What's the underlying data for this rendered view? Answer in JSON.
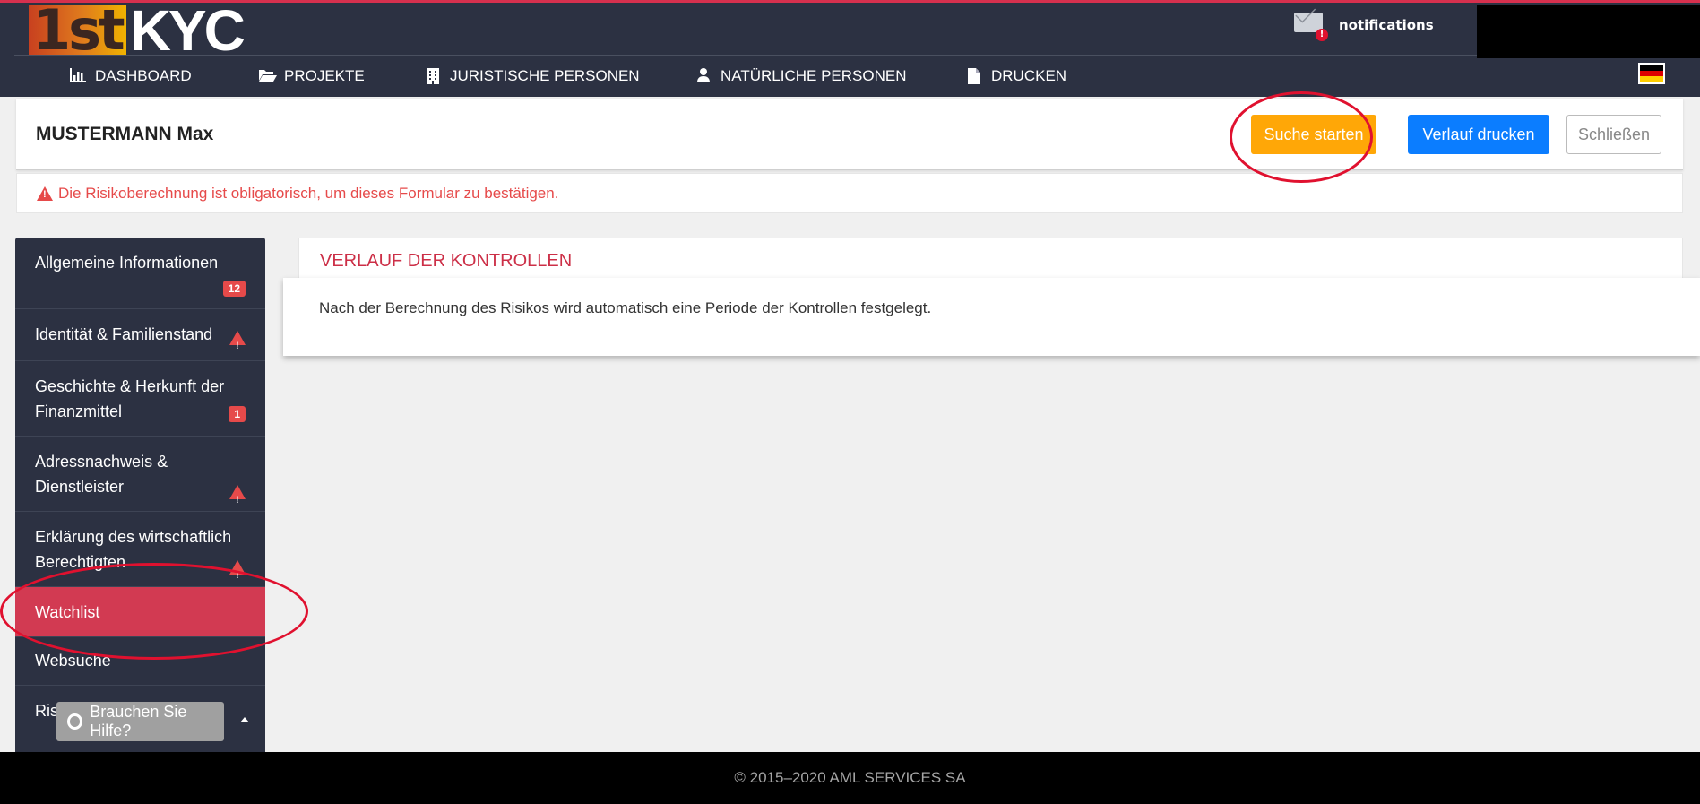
{
  "header": {
    "logo_first": "1st",
    "logo_kyc": "KYC",
    "notifications_label": "notifications",
    "notifications_badge": "!",
    "nav": [
      {
        "label": "DASHBOARD",
        "icon": "bar-chart-icon"
      },
      {
        "label": "PROJEKTE",
        "icon": "folder-open-icon"
      },
      {
        "label": "JURISTISCHE PERSONEN",
        "icon": "building-icon"
      },
      {
        "label": "NATÜRLICHE PERSONEN",
        "icon": "user-icon",
        "active": true
      },
      {
        "label": "DRUCKEN",
        "icon": "document-icon"
      }
    ],
    "language_flag": "german-flag-icon"
  },
  "titlebar": {
    "name": "MUSTERMANN Max",
    "search_button": "Suche starten",
    "print_button": "Verlauf drucken",
    "close_button": "Schließen"
  },
  "warning": {
    "message": "Die Risikoberechnung ist obligatorisch, um dieses Formular zu bestätigen."
  },
  "sidebar": {
    "items": [
      {
        "label": "Allgemeine Informationen",
        "badge": "12"
      },
      {
        "label": "Identität & Familienstand",
        "warning": true
      },
      {
        "label": "Geschichte & Herkunft der Finanzmittel",
        "badge": "1"
      },
      {
        "label": "Adressnachweis & Dienstleister",
        "warning": true
      },
      {
        "label": "Erklärung des wirtschaftlich Berechtigten",
        "warning": true
      },
      {
        "label": "Watchlist",
        "active": true
      },
      {
        "label": "Websuche"
      },
      {
        "label": "Ris"
      }
    ],
    "help_button": "Brauchen Sie Hilfe?"
  },
  "panel": {
    "title": "VERLAUF DER KONTROLLEN",
    "body": "Nach der Berechnung des Risikos wird automatisch eine Periode der Kontrollen festgelegt."
  },
  "footer": {
    "copyright": "© 2015–2020 AML SERVICES SA"
  },
  "colors": {
    "header_bg": "#2c3142",
    "accent_red": "#d23a52",
    "orange": "#ffa707",
    "blue": "#0b7dff",
    "annotation_red": "#e0112f"
  }
}
